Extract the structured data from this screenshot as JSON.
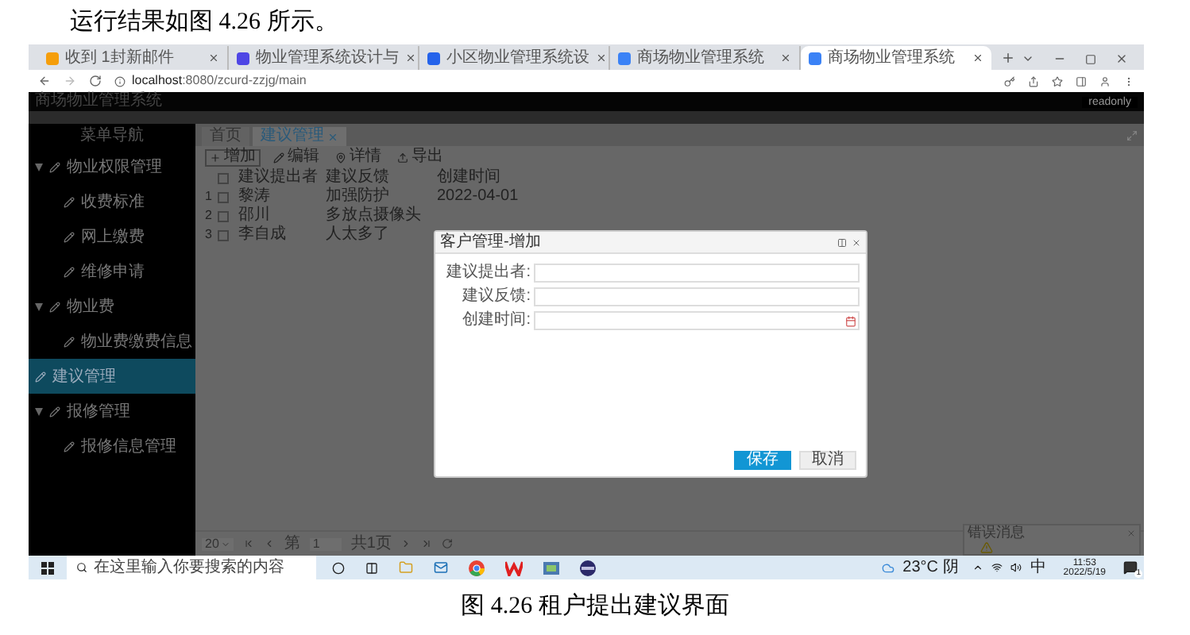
{
  "document": {
    "intro": "运行结果如图 4.26 所示。",
    "caption": "图 4.26 租户提出建议界面"
  },
  "browser": {
    "tabs": [
      {
        "title": "收到 1封新邮件",
        "selected": false
      },
      {
        "title": "物业管理系统设计与",
        "selected": false
      },
      {
        "title": "小区物业管理系统设",
        "selected": false
      },
      {
        "title": "商场物业管理系统",
        "selected": false
      },
      {
        "title": "商场物业管理系统",
        "selected": true
      }
    ],
    "url_host": "localhost",
    "url_path": ":8080/zcurd-zzjg/main"
  },
  "app": {
    "title": "商场物业管理系统",
    "user": "readonly"
  },
  "sidebar": {
    "title": "菜单导航",
    "items": [
      {
        "label": "物业权限管理",
        "expanded": true,
        "selected": false,
        "children": [
          {
            "label": "收费标准",
            "selected": false
          },
          {
            "label": "网上缴费",
            "selected": false
          },
          {
            "label": "维修申请",
            "selected": false
          }
        ]
      },
      {
        "label": "物业费",
        "expanded": true,
        "selected": false,
        "children": [
          {
            "label": "物业费缴费信息",
            "selected": false
          }
        ]
      },
      {
        "label": "建议管理",
        "selected": true
      },
      {
        "label": "报修管理",
        "expanded": true,
        "selected": false,
        "children": [
          {
            "label": "报修信息管理",
            "selected": false
          }
        ]
      }
    ]
  },
  "content_tabs": [
    {
      "label": "首页",
      "selected": false,
      "closable": false
    },
    {
      "label": "建议管理",
      "selected": true,
      "closable": true
    }
  ],
  "toolbar": [
    {
      "label": "增加",
      "kind": "add"
    },
    {
      "label": "编辑",
      "kind": "edit"
    },
    {
      "label": "详情",
      "kind": "detail"
    },
    {
      "label": "导出",
      "kind": "export"
    }
  ],
  "table": {
    "all_checked": false,
    "columns": [
      "建议提出者",
      "建议反馈",
      "创建时间"
    ],
    "rows": [
      {
        "index": "1",
        "checked": false,
        "cells": [
          "黎涛",
          "加强防护",
          "2022-04-01"
        ]
      },
      {
        "index": "2",
        "checked": false,
        "cells": [
          "邵川",
          "多放点摄像头",
          ""
        ]
      },
      {
        "index": "3",
        "checked": false,
        "cells": [
          "李自成",
          "人太多了",
          ""
        ]
      }
    ]
  },
  "pagination": {
    "page_size": "20",
    "page_prefix": "第",
    "page": "1",
    "total": "共1页"
  },
  "dialog": {
    "title": "客户管理-增加",
    "fields": [
      {
        "label": "建议提出者:",
        "kind": "text"
      },
      {
        "label": "建议反馈:",
        "kind": "text"
      },
      {
        "label": "创建时间:",
        "kind": "date"
      }
    ],
    "buttons": [
      {
        "label": "保存",
        "kind": "primary"
      },
      {
        "label": "取消",
        "kind": "secondary"
      }
    ]
  },
  "error_popup": {
    "title": "错误消息"
  },
  "taskbar": {
    "search_placeholder": "在这里输入你要搜索的内容",
    "weather": "23°C 阴",
    "ime": "中",
    "time": "11:53",
    "date": "2022/5/19",
    "notifications": "1"
  }
}
